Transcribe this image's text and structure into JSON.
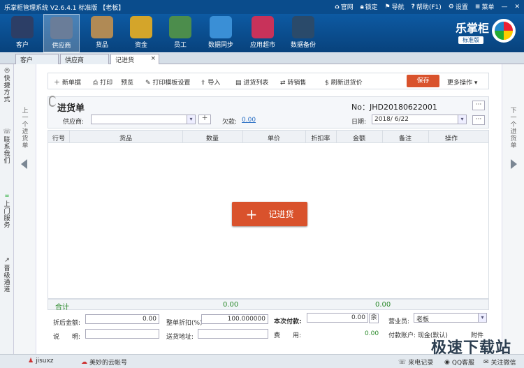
{
  "app": {
    "title": "乐掌柜管理系统 V2.6.4.1 标准版 【老板】",
    "brand": "乐掌柜",
    "edition": "标准版"
  },
  "titlemenu": [
    "官网",
    "锁定",
    "导航",
    "帮助(F1)",
    "设置",
    "菜单"
  ],
  "toolbar": [
    "客户",
    "供应商",
    "货品",
    "资金",
    "员工",
    "数据同步",
    "应用超市",
    "数据备份"
  ],
  "tabs": [
    "客户",
    "供应商",
    "记进货"
  ],
  "leftbar": [
    "快捷方式",
    "联系我们",
    "上门服务",
    "晋级通道"
  ],
  "nav": {
    "prev": "上一个进货单",
    "next": "下一个进货单"
  },
  "actions": [
    "新单据",
    "打印",
    "预览",
    "打印模板设置",
    "导入",
    "进货列表",
    "转销售",
    "刷新进货价"
  ],
  "save": "保存",
  "more": "更多操作",
  "form": {
    "title": "进货单",
    "no": "No：JHD20180622001",
    "supplier_label": "供应商:",
    "supplier_value": "",
    "debt_label": "欠款:",
    "debt_value": "0.00",
    "date_label": "日期:",
    "date_value": "2018/ 6/22"
  },
  "columns": [
    "行号",
    "货品",
    "数量",
    "单价",
    "折扣率",
    "金额",
    "备注",
    "操作"
  ],
  "big_button": "记进货",
  "sum": {
    "label": "合计",
    "qty": "0.00",
    "amount": "0.00"
  },
  "bottom": {
    "after_discount_label": "折后金额:",
    "after_discount": "0.00",
    "whole_discount_label": "整单折扣(%)",
    "whole_discount": "100.000000",
    "payment_label": "本次付款:",
    "payment": "0.00",
    "remain": "余",
    "salesman_label": "营业员:",
    "salesman": "老板",
    "note_label": "说　　明:",
    "address_label": "送货地址:",
    "fee_label": "费　　用:",
    "fee": "0.00",
    "account": "付款账户: 现金(默认)",
    "attach": "附件"
  },
  "status": {
    "user": "jisuxz",
    "cloud": "美妙的云帐号",
    "calls": "来电记录",
    "qq": "QQ客服",
    "wechat": "关注微信"
  },
  "watermark": "极速下载站",
  "colors": {
    "titlebar": "#0a4c8c",
    "accent": "#d9522c",
    "sum_text": "#2b8a2b"
  }
}
